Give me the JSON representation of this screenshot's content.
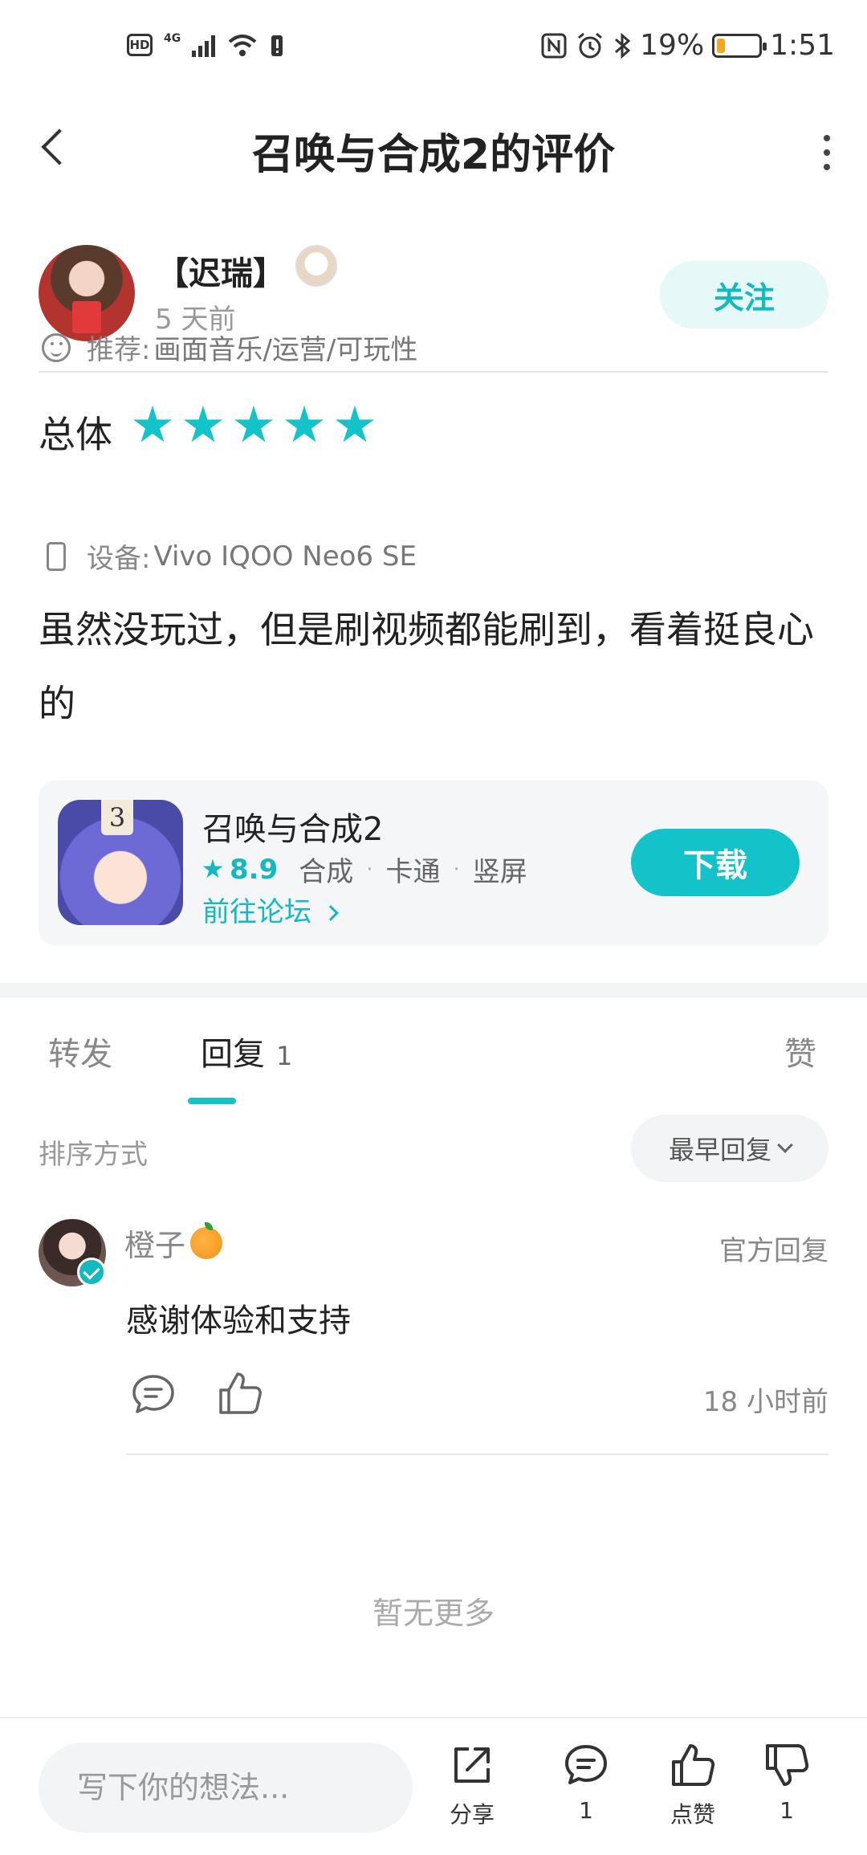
{
  "status_bar": {
    "left_badge": "HD",
    "network": "4G",
    "battery_text": "19%",
    "time": "1:51",
    "battery_level": 0.19
  },
  "header": {
    "title": "召唤与合成2的评价"
  },
  "author": {
    "name": "【迟瑞】",
    "time": "5 天前",
    "follow_label": "关注"
  },
  "rating": {
    "label": "总体",
    "stars": 5,
    "max_stars": 5,
    "star_color": "#14c2c9"
  },
  "meta": {
    "recommend_label": "推荐:",
    "recommend_value": "画面音乐/运营/可玩性",
    "device_label": "设备:",
    "device_value": "Vivo IQOO Neo6 SE"
  },
  "review": {
    "text": "虽然没玩过，但是刷视频都能刷到，看着挺良心的"
  },
  "app_card": {
    "icon_tag": "3",
    "name": "召唤与合成2",
    "score": "8.9",
    "tags": [
      "合成",
      "卡通",
      "竖屏"
    ],
    "forum_link": "前往论坛",
    "download_label": "下载"
  },
  "tabs": {
    "forward": "转发",
    "reply": "回复",
    "reply_count": "1",
    "like": "赞"
  },
  "sort": {
    "label": "排序方式",
    "selected": "最早回复"
  },
  "reply": {
    "name": "橙子",
    "official_tag": "官方回复",
    "text": "感谢体验和支持",
    "time": "18 小时前"
  },
  "list_end": "暂无更多",
  "bottom_bar": {
    "input_placeholder": "写下你的想法...",
    "share_label": "分享",
    "comment_count": "1",
    "like_label": "点赞",
    "dislike_count": "1"
  },
  "colors": {
    "accent": "#14c2c9",
    "accent_text": "#14b8bf",
    "follow_bg": "#e7f8f8"
  }
}
